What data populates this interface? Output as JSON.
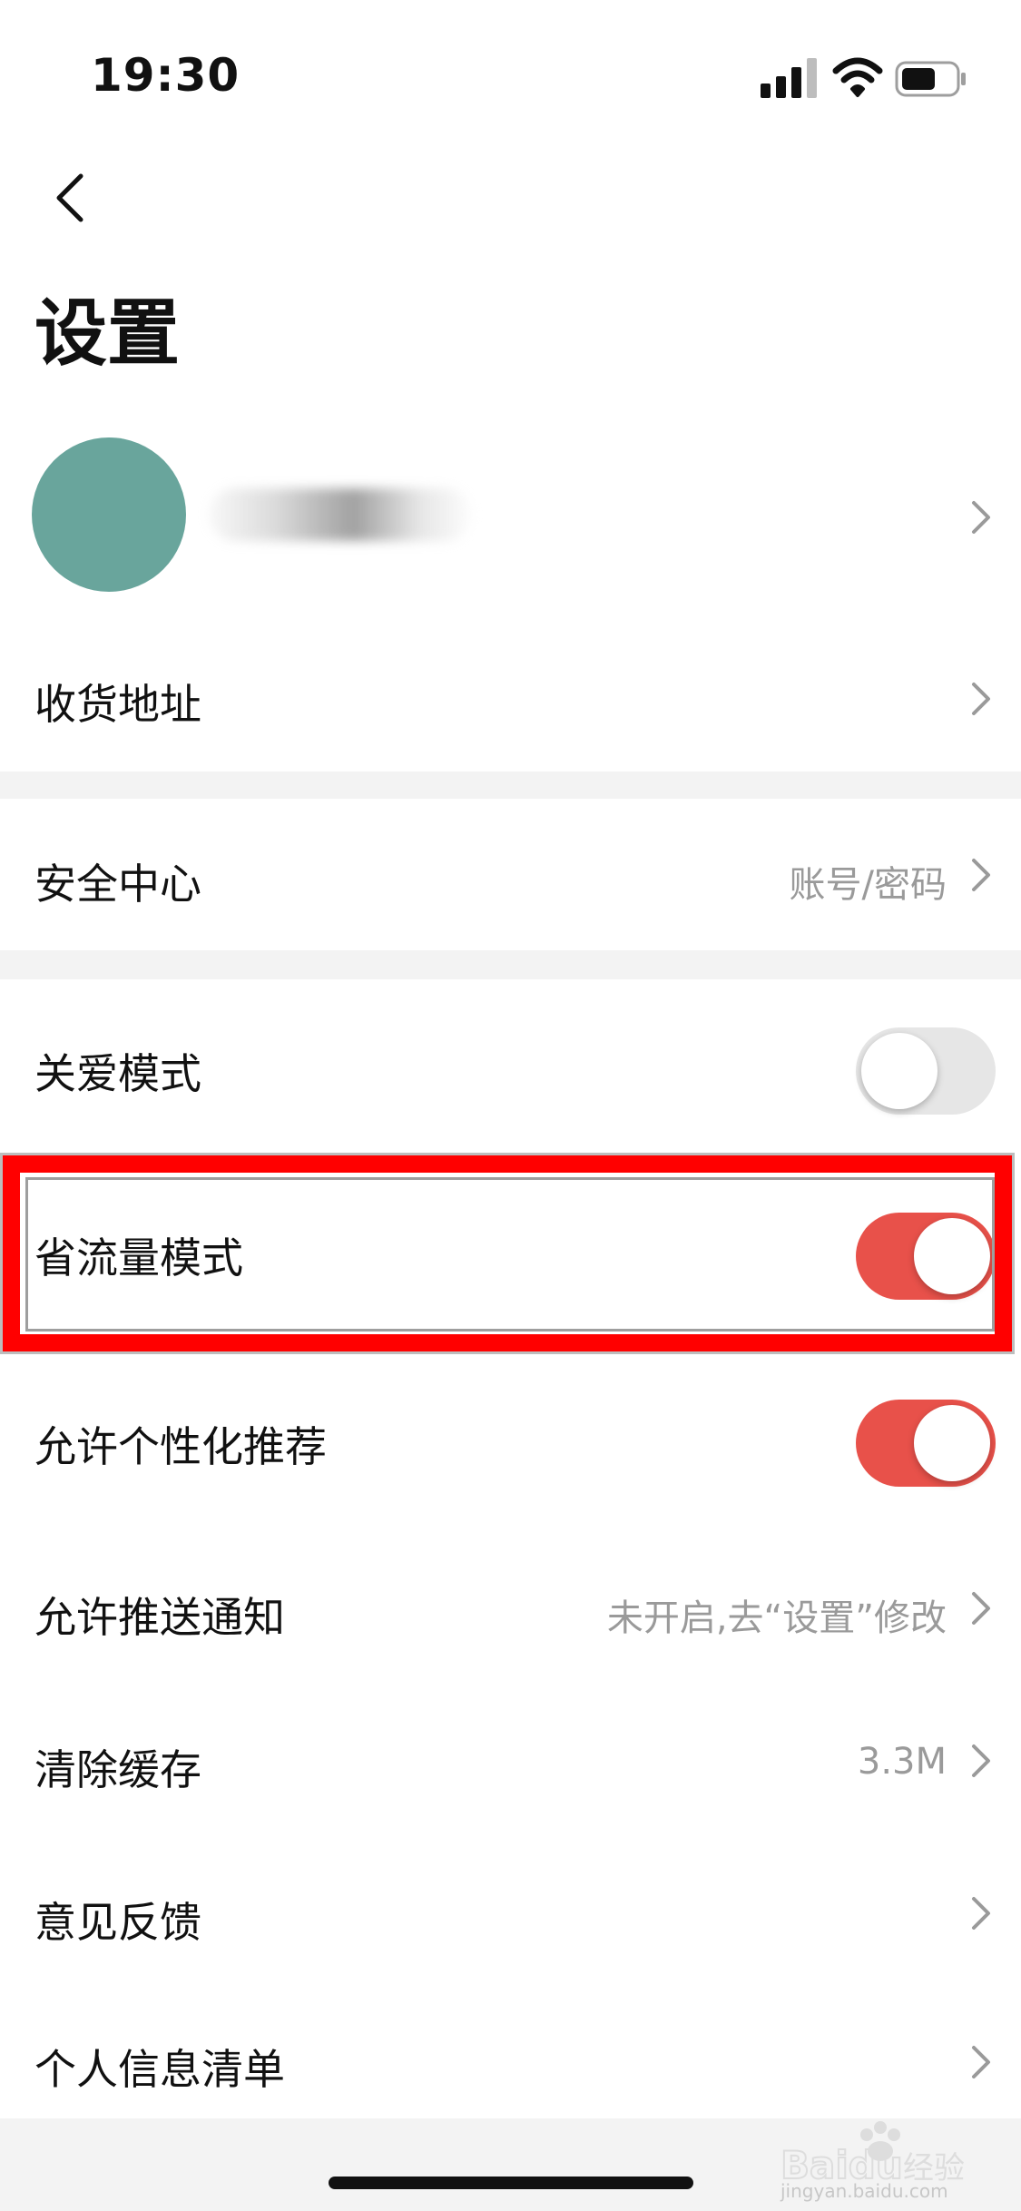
{
  "status_bar": {
    "time": "19:30"
  },
  "header": {
    "title": "设置"
  },
  "address": {
    "label": "收货地址"
  },
  "security": {
    "label": "安全中心",
    "value": "账号/密码"
  },
  "care_mode": {
    "label": "关爱模式",
    "enabled": false
  },
  "data_saver": {
    "label": "省流量模式",
    "enabled": true,
    "highlighted": true
  },
  "personalized": {
    "label": "允许个性化推荐",
    "enabled": true
  },
  "push": {
    "label": "允许推送通知",
    "value": "未开启,去“设置”修改"
  },
  "cache": {
    "label": "清除缓存",
    "value": "3.3M"
  },
  "feedback": {
    "label": "意见反馈"
  },
  "personal_info": {
    "label": "个人信息清单"
  },
  "watermark": {
    "text": "jingyan.baidu.com"
  },
  "colors": {
    "toggle_on": "#e8514a",
    "toggle_off": "#e6e6e6",
    "highlight": "#ff0000",
    "avatar": "#69a59c",
    "section_gap": "#f3f3f3"
  },
  "icons": [
    "back-icon",
    "chevron-right-icon",
    "signal-icon",
    "wifi-icon",
    "battery-icon"
  ]
}
